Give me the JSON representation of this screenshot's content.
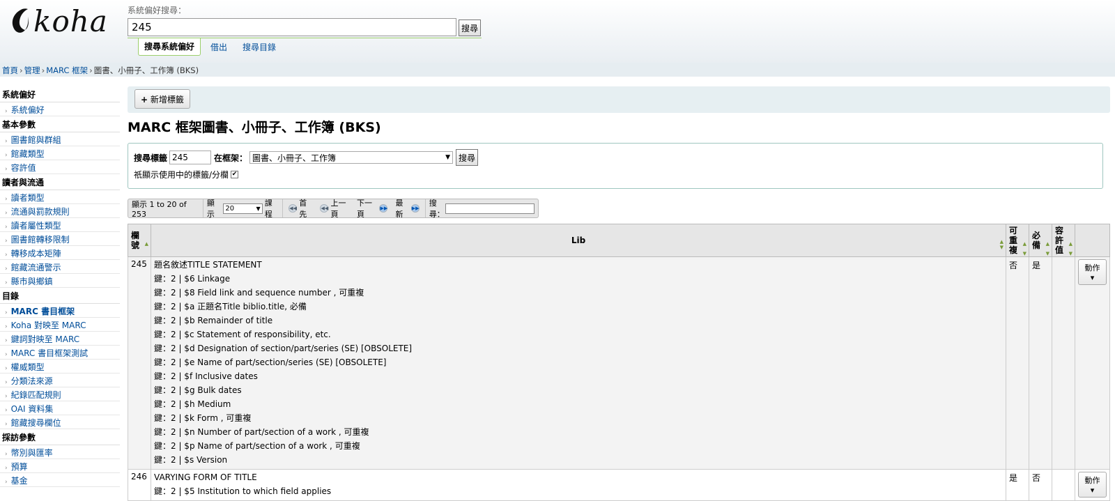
{
  "header": {
    "logo_text": "koha",
    "search_label": "系統偏好搜尋：",
    "search_value": "245",
    "search_button": "搜尋",
    "tabs": [
      {
        "label": "搜尋系統偏好",
        "active": true
      },
      {
        "label": "借出",
        "active": false
      },
      {
        "label": "搜尋目錄",
        "active": false
      }
    ]
  },
  "breadcrumbs": [
    "首頁",
    "管理",
    "MARC 框架",
    "圖書、小冊子、工作簿 (BKS)"
  ],
  "sidebar": {
    "sections": [
      {
        "heading": "系統偏好",
        "items": [
          "系統偏好"
        ]
      },
      {
        "heading": "基本參數",
        "items": [
          "圖書館與群組",
          "館藏類型",
          "容許值"
        ]
      },
      {
        "heading": "讀者與流通",
        "items": [
          "讀者類型",
          "流通與罰款規則",
          "讀者屬性類型",
          "圖書館轉移限制",
          "轉移成本矩陣",
          "館藏流通警示",
          "縣市與鄉鎮"
        ]
      },
      {
        "heading": "目錄",
        "items": [
          "MARC 書目框架",
          "Koha 對映至 MARC",
          "鍵詞對映至 MARC",
          "MARC 書目框架測試",
          "權威類型",
          "分類法來源",
          "紀錄匹配規則",
          "OAI 資料集",
          "館藏搜尋欄位"
        ]
      },
      {
        "heading": "採訪參數",
        "items": [
          "幣別與匯率",
          "預算",
          "基金"
        ]
      }
    ]
  },
  "toolbar": {
    "new_tag_label": "新增標籤"
  },
  "page_title": "MARC 框架圖書、小冊子、工作簿 (BKS)",
  "filter": {
    "tag_label": "搜尋標籤",
    "tag_value": "245",
    "framework_label": "在框架：",
    "framework_value": "圖書、小冊子、工作簿",
    "search_button": "搜尋",
    "only_used_label": "祇顯示使用中的標籤/分欄",
    "only_used_checked": true
  },
  "pager": {
    "info": "顯示 1 to 20 of 253",
    "show_label": "顯示",
    "per_page": "20",
    "entries_label": "課程",
    "first": "首先",
    "prev": "上一頁",
    "next": "下一頁",
    "last": "最新",
    "search_label": "搜尋："
  },
  "table": {
    "headers": {
      "tag": "欄號",
      "lib": "Lib",
      "repeatable": "可重複",
      "mandatory": "必備",
      "authorised": "容許值"
    },
    "actions_label": "動作",
    "rows": [
      {
        "tag": "245",
        "title": "題名敘述TITLE STATEMENT",
        "repeatable": "否",
        "mandatory": "是",
        "subfields": [
          "鍵：2 | $6 Linkage",
          "鍵：2 | $8 Field link and sequence number , 可重複",
          "鍵：2 | $a 正題名Title biblio.title, 必備",
          "鍵：2 | $b Remainder of title",
          "鍵：2 | $c Statement of responsibility, etc.",
          "鍵：2 | $d Designation of section/part/series (SE) [OBSOLETE]",
          "鍵：2 | $e Name of part/section/series (SE) [OBSOLETE]",
          "鍵：2 | $f Inclusive dates",
          "鍵：2 | $g Bulk dates",
          "鍵：2 | $h Medium",
          "鍵：2 | $k Form , 可重複",
          "鍵：2 | $n Number of part/section of a work , 可重複",
          "鍵：2 | $p Name of part/section of a work , 可重複",
          "鍵：2 | $s Version"
        ]
      },
      {
        "tag": "246",
        "title": "VARYING FORM OF TITLE",
        "repeatable": "是",
        "mandatory": "否",
        "subfields": [
          "鍵：2 | $5 Institution to which field applies"
        ]
      }
    ]
  }
}
